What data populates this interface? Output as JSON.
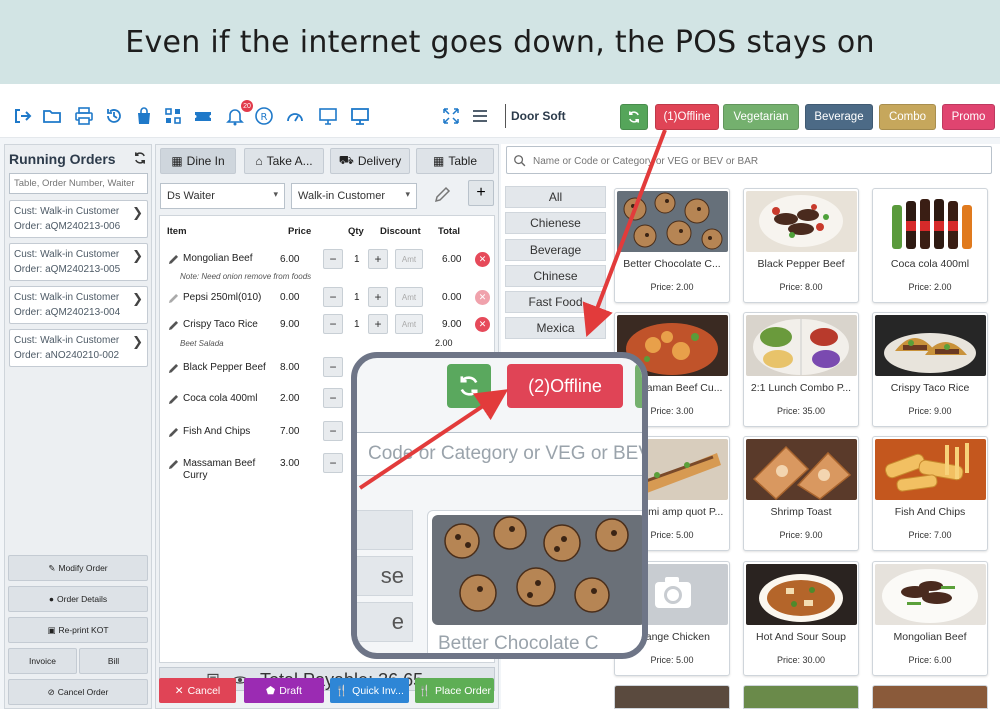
{
  "banner": {
    "headline": "Even if the internet goes down, the POS stays on"
  },
  "toolbar": {
    "icons": [
      "logout-icon",
      "folder-icon",
      "print-icon",
      "history-icon",
      "bag-icon",
      "grid-icon",
      "ticket-icon",
      "bell-icon",
      "registered-icon",
      "dashboard-icon",
      "monitor-icon",
      "display-icon",
      "fullscreen-icon",
      "menu-icon"
    ],
    "notification_count": "20",
    "brand": "Door Soft",
    "buttons": {
      "offline": "(1)Offline",
      "vegetarian": "Vegetarian",
      "beverage": "Beverage",
      "combo": "Combo",
      "promo": "Promo"
    },
    "colors": {
      "refresh": "#55a55a",
      "offline": "#e04456",
      "vegetarian": "#74b06e",
      "beverage": "#4c6a86",
      "combo": "#c6a75c",
      "promo": "#e04470"
    }
  },
  "running_orders": {
    "title": "Running Orders",
    "search_placeholder": "Table, Order Number, Waiter",
    "orders": [
      {
        "customer": "Cust: Walk-in Customer",
        "order": "Order: aQM240213-006"
      },
      {
        "customer": "Cust: Walk-in Customer",
        "order": "Order: aQM240213-005"
      },
      {
        "customer": "Cust: Walk-in Customer",
        "order": "Order: aQM240213-004"
      },
      {
        "customer": "Cust: Walk-in Customer",
        "order": "Order: aNO240210-002"
      }
    ],
    "buttons": {
      "modify": "Modify Order",
      "details": "Order Details",
      "reprint": "Re-print KOT",
      "invoice": "Invoice",
      "bill": "Bill",
      "cancel": "Cancel Order"
    }
  },
  "order": {
    "tabs": {
      "dine_in": "Dine In",
      "take_away": "Take A...",
      "delivery": "Delivery",
      "table": "Table"
    },
    "waiter": "Ds Waiter",
    "customer": "Walk-in Customer",
    "headers": {
      "item": "Item",
      "price": "Price",
      "qty": "Qty",
      "discount": "Discount",
      "total": "Total"
    },
    "amount_placeholder": "Amt",
    "items": [
      {
        "name": "Mongolian Beef",
        "price": "6.00",
        "qty": "1",
        "total": "6.00",
        "note": "Note: Need onion remove from foods"
      },
      {
        "name": "Pepsi 250ml(010)",
        "price": "0.00",
        "qty": "1",
        "total": "0.00"
      },
      {
        "name": "Crispy Taco Rice",
        "price": "9.00",
        "qty": "1",
        "total": "9.00",
        "note": "Beet   Salada",
        "extra": "2.00"
      },
      {
        "name": "Black Pepper Beef",
        "price": "8.00",
        "qty": "1"
      },
      {
        "name": "Coca cola 400ml",
        "price": "2.00"
      },
      {
        "name": "Fish And Chips",
        "price": "7.00"
      },
      {
        "name": "Massaman Beef Curry",
        "price": "3.00"
      }
    ],
    "total_label": "Total Payable: 36.65",
    "actions": {
      "cancel": "Cancel",
      "draft": "Draft",
      "quick_invoice": "Quick Inv...",
      "place_order": "Place Order"
    }
  },
  "products": {
    "search_placeholder": "Name or Code or Category or VEG or BEV or BAR",
    "categories": [
      "All",
      "Chienese",
      "Beverage",
      "Chinese",
      "Fast Food",
      "Mexica"
    ],
    "items": [
      {
        "name": "Better Chocolate C...",
        "price": "Price: 2.00"
      },
      {
        "name": "Black Pepper Beef",
        "price": "Price: 8.00"
      },
      {
        "name": "Coca cola 400ml",
        "price": "Price: 2.00"
      },
      {
        "name": "Massaman Beef Cu...",
        "price": "Price: 3.00"
      },
      {
        "name": "2:1 Lunch Combo P...",
        "price": "Price: 35.00"
      },
      {
        "name": "Crispy Taco Rice",
        "price": "Price: 9.00"
      },
      {
        "name": "Banh mi amp quot P...",
        "price": "Price: 5.00"
      },
      {
        "name": "Shrimp Toast",
        "price": "Price: 9.00"
      },
      {
        "name": "Fish And Chips",
        "price": "Price: 7.00"
      },
      {
        "name": "Orange Chicken",
        "price": "Price: 5.00"
      },
      {
        "name": "Hot And Sour Soup",
        "price": "Price: 30.00"
      },
      {
        "name": "Mongolian Beef",
        "price": "Price: 6.00"
      }
    ]
  },
  "zoom": {
    "offline": "(2)Offline",
    "search_fragment": "Code or Category or VEG or BEV or",
    "cat_fragments": [
      "e",
      "se",
      "e"
    ],
    "product_fragment": "Better Chocolate C"
  }
}
